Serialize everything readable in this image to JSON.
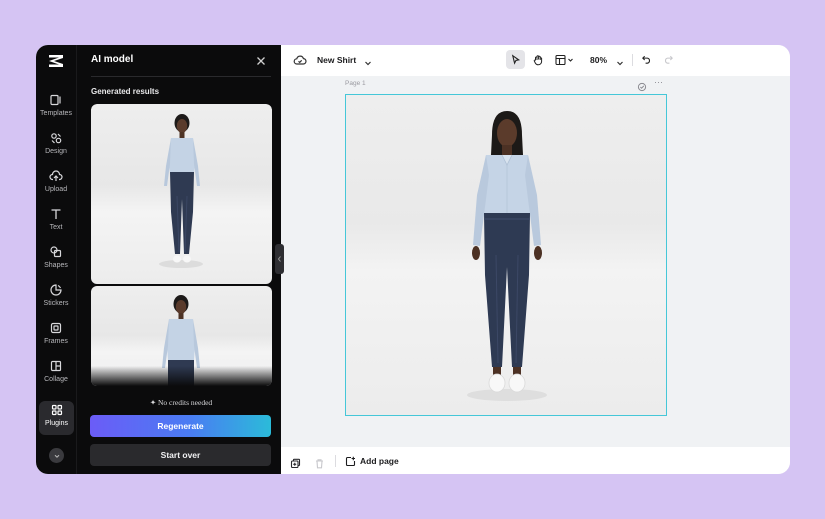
{
  "sidebar": {
    "logo": "capcut-logo",
    "items": [
      {
        "label": "Templates",
        "icon": "templates-icon"
      },
      {
        "label": "Design",
        "icon": "design-icon"
      },
      {
        "label": "Upload",
        "icon": "upload-icon"
      },
      {
        "label": "Text",
        "icon": "text-icon"
      },
      {
        "label": "Shapes",
        "icon": "shapes-icon"
      },
      {
        "label": "Stickers",
        "icon": "stickers-icon"
      },
      {
        "label": "Frames",
        "icon": "frames-icon"
      },
      {
        "label": "Collage",
        "icon": "collage-icon"
      },
      {
        "label": "Plugins",
        "icon": "plugins-icon",
        "active": true
      }
    ]
  },
  "panel": {
    "title": "AI model",
    "section_label": "Generated results",
    "credits_note": "✦ No credits needed",
    "regenerate_label": "Regenerate",
    "start_over_label": "Start over"
  },
  "toolbar": {
    "doc_title": "New Shirt",
    "zoom": "80%"
  },
  "canvas": {
    "page_label": "Page 1"
  },
  "bottombar": {
    "add_page_label": "Add page"
  },
  "colors": {
    "background": "#d5c4f3",
    "panel": "#0b0b0c",
    "regenerate_gradient_start": "#6b5cf7",
    "regenerate_gradient_end": "#2bbbd9",
    "selection_border": "#45c7d8"
  }
}
